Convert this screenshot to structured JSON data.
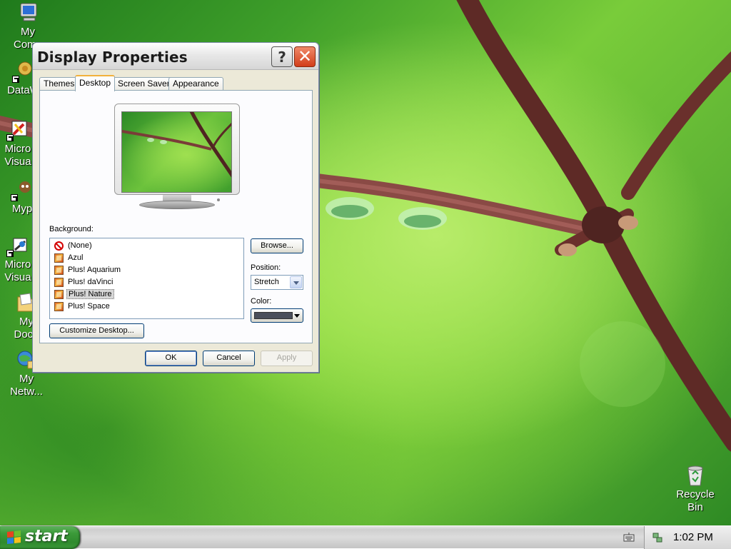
{
  "desktop": {
    "icons": [
      {
        "label": "My\nComp",
        "icon": "my-computer-icon"
      },
      {
        "label": "DataW",
        "icon": "datawatch-shortcut-icon"
      },
      {
        "label": "Micro\nVisua",
        "icon": "microsoft-visual-shortcut-icon"
      },
      {
        "label": "Myp",
        "icon": "myp-shortcut-icon"
      },
      {
        "label": "Micro\nVisua",
        "icon": "microsoft-visual-shortcut-icon"
      },
      {
        "label": "My\nDocu",
        "icon": "my-documents-icon"
      },
      {
        "label": "My\nNetw...",
        "icon": "my-network-places-icon"
      },
      {
        "label": "Recycle\nBin",
        "icon": "recycle-bin-icon"
      }
    ]
  },
  "dialog": {
    "title": "Display Properties",
    "help_glyph": "?",
    "close_glyph": "✕",
    "tabs": [
      {
        "label": "Themes",
        "active": false
      },
      {
        "label": "Desktop",
        "active": true
      },
      {
        "label": "Screen Saver",
        "active": false
      },
      {
        "label": "Appearance",
        "active": false
      }
    ],
    "background_label": "Background:",
    "backgrounds": [
      {
        "label": "(None)",
        "icon": "none-icon"
      },
      {
        "label": "Azul",
        "icon": "image-file-icon"
      },
      {
        "label": "Plus! Aquarium",
        "icon": "image-file-icon"
      },
      {
        "label": "Plus! daVinci",
        "icon": "image-file-icon"
      },
      {
        "label": "Plus! Nature",
        "icon": "image-file-icon",
        "selected": true
      },
      {
        "label": "Plus! Space",
        "icon": "image-file-icon"
      }
    ],
    "browse_label": "Browse...",
    "position_label": "Position:",
    "position_value": "Stretch",
    "color_label": "Color:",
    "color_value": "#4b4f5a",
    "customize_label": "Customize Desktop...",
    "ok_label": "OK",
    "cancel_label": "Cancel",
    "apply_label": "Apply"
  },
  "taskbar": {
    "start_label": "start",
    "clock": "1:02 PM"
  },
  "colors": {
    "accent_tab": "#f2b13c",
    "start_green": "#3c9b3a",
    "close_red": "#d23d1a"
  }
}
